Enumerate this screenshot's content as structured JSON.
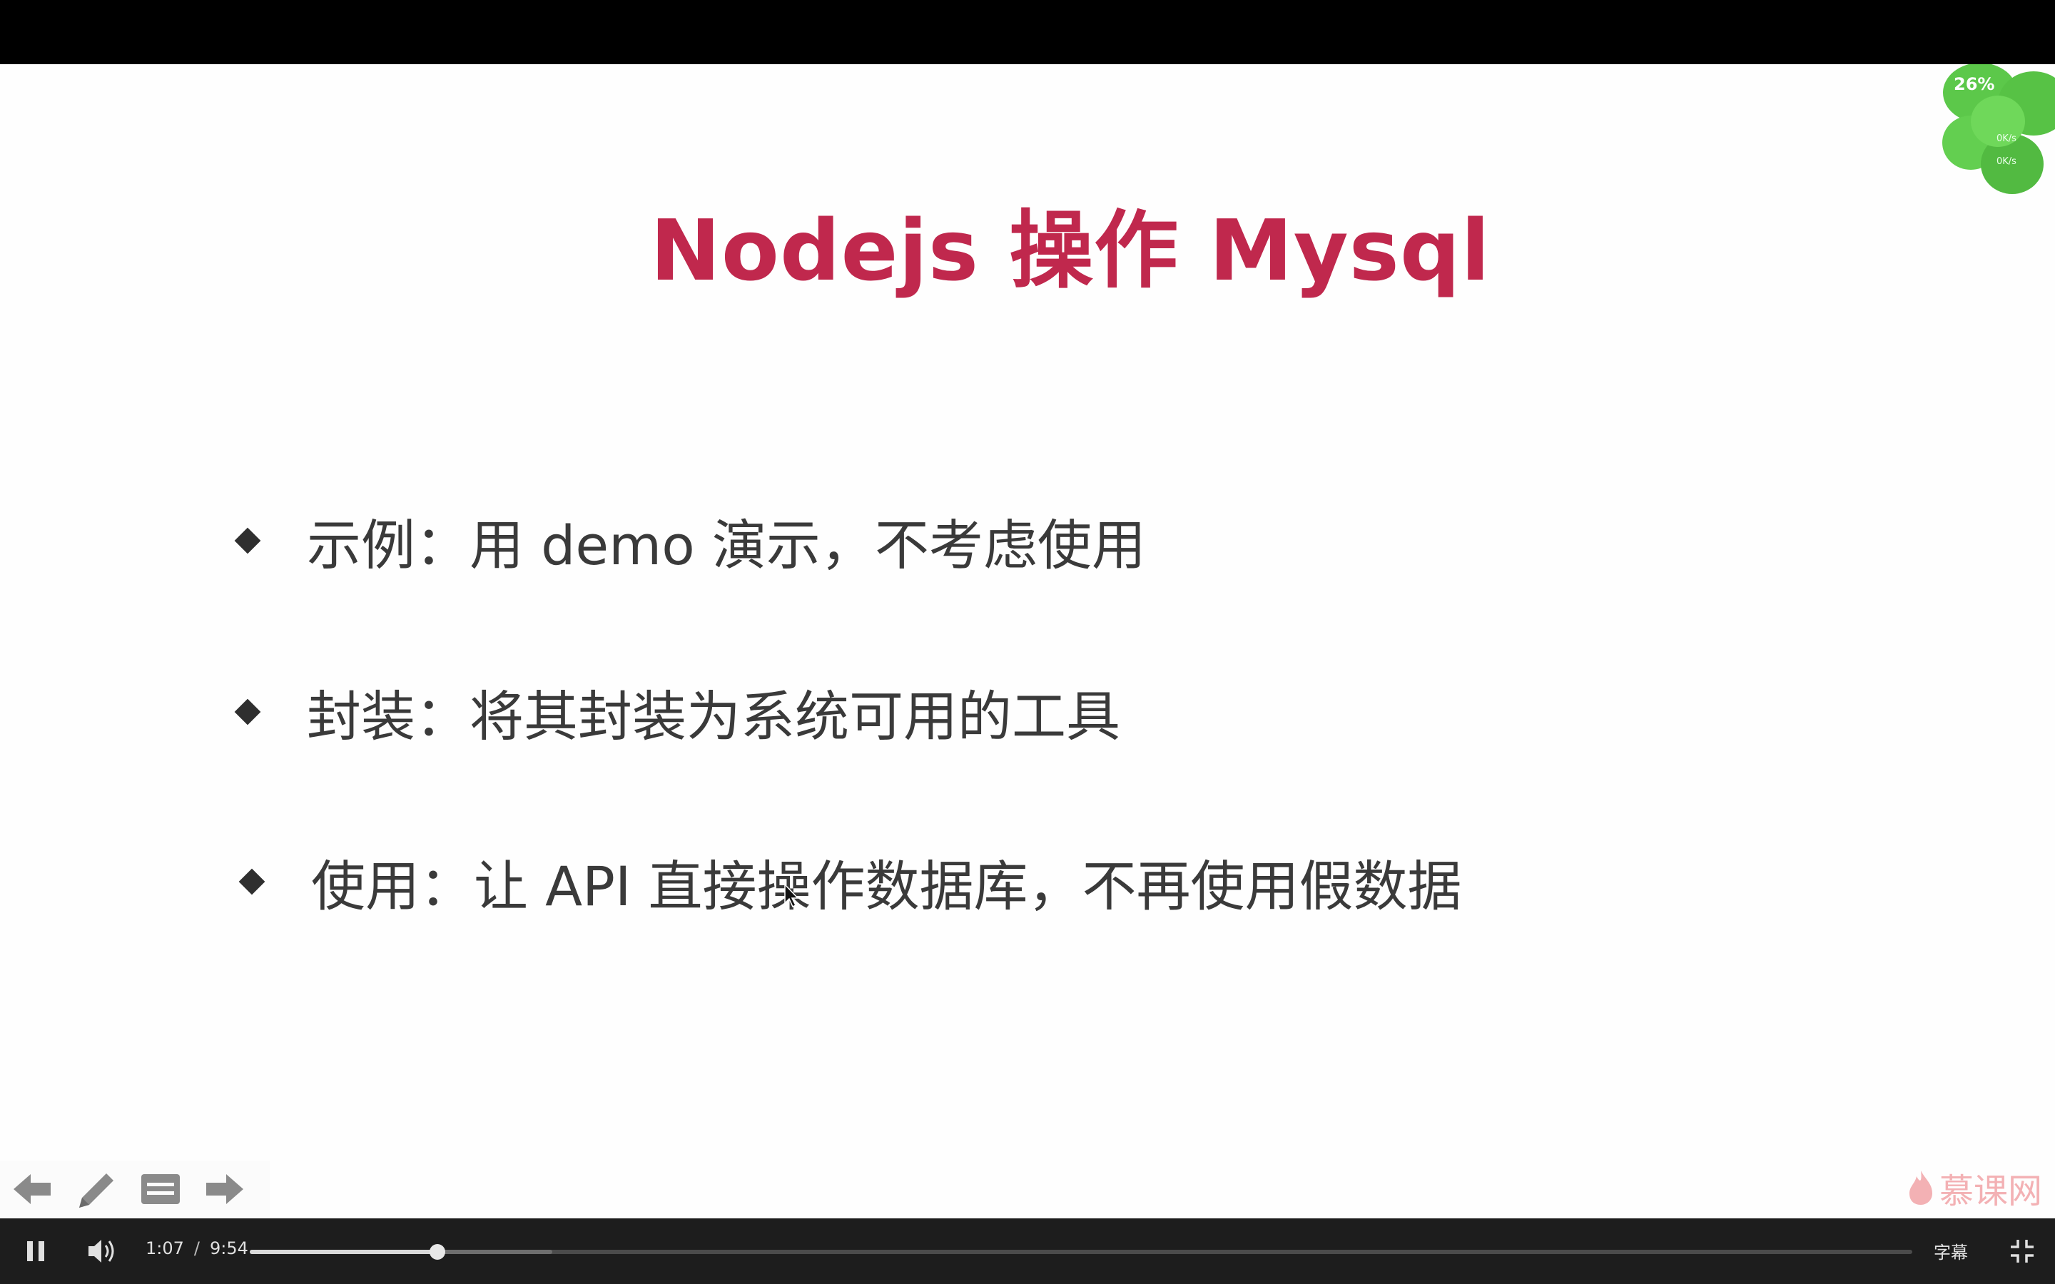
{
  "slide": {
    "title": "Nodejs 操作 Mysql",
    "bullets": [
      "示例：用 demo 演示，不考虑使用",
      "封装：将其封装为系统可用的工具",
      "使用：让 API 直接操作数据库，不再使用假数据"
    ]
  },
  "widget": {
    "percent": "26%",
    "up_speed": "0K/s",
    "down_speed": "0K/s"
  },
  "watermark": {
    "text": "慕课网"
  },
  "slide_tools": {
    "icons": [
      "arrow-left-icon",
      "pencil-icon",
      "menu-icon",
      "arrow-right-icon"
    ]
  },
  "player": {
    "current_time": "1:07",
    "separator": "/",
    "duration": "9:54",
    "progress_fraction": 0.113,
    "buffered_fraction": 0.182,
    "subtitle_label": "字幕"
  },
  "colors": {
    "title": "#c0284d",
    "player_bg": "#1d1d1d",
    "clover_green": "#5cc84a"
  }
}
